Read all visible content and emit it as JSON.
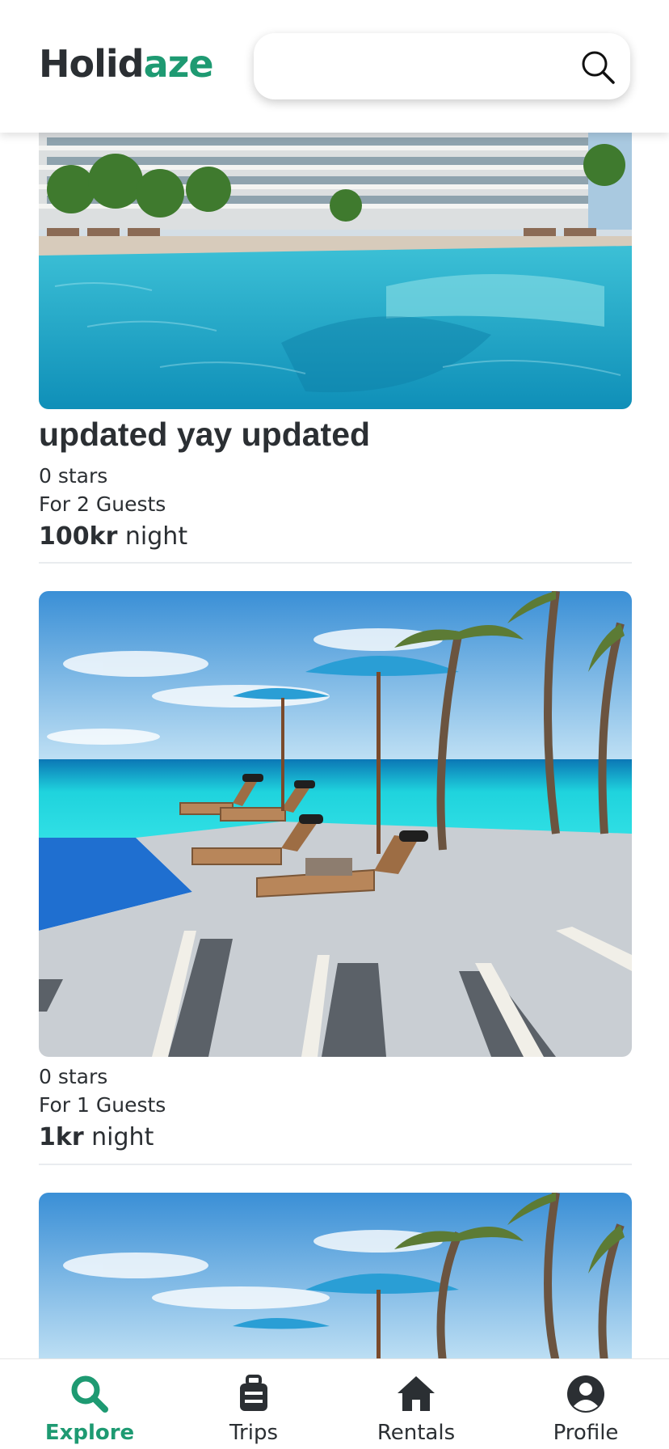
{
  "app": {
    "logo_primary": "Holid",
    "logo_accent": "aze",
    "accent_color": "#1e9a72"
  },
  "search": {
    "placeholder": "",
    "value": "",
    "icon": "search-icon"
  },
  "listings": [
    {
      "title": "updated yay updated",
      "stars": "0 stars",
      "guests": "For 2 Guests",
      "price": "100kr",
      "price_unit": " night",
      "image": "hotel-pool-photo"
    },
    {
      "title": "",
      "stars": "0 stars",
      "guests": "For 1 Guests",
      "price": "1kr",
      "price_unit": " night",
      "image": "beach-loungers-photo"
    },
    {
      "title": "",
      "image": "beach-loungers-photo"
    }
  ],
  "nav": {
    "items": [
      {
        "label": "Explore",
        "icon": "search-icon",
        "active": true
      },
      {
        "label": "Trips",
        "icon": "suitcase-icon",
        "active": false
      },
      {
        "label": "Rentals",
        "icon": "house-icon",
        "active": false
      },
      {
        "label": "Profile",
        "icon": "user-icon",
        "active": false
      }
    ]
  }
}
